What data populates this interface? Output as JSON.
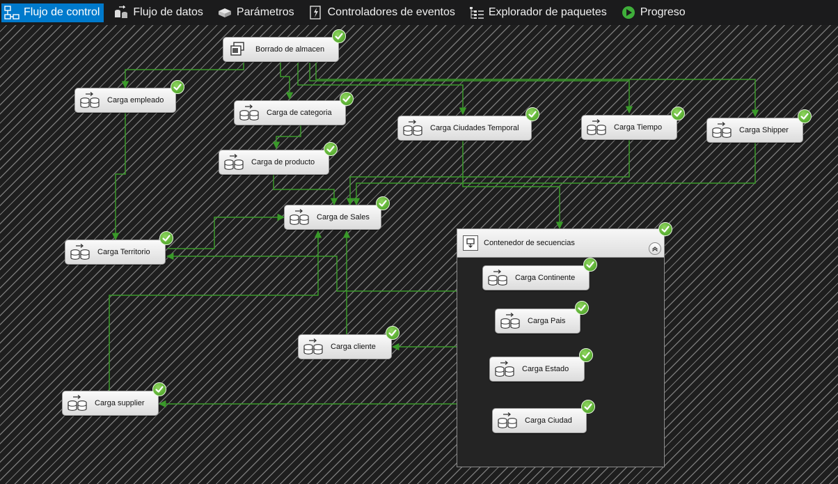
{
  "tabs": [
    {
      "label": "Flujo de control",
      "icon": "control-flow-icon",
      "active": true
    },
    {
      "label": "Flujo de datos",
      "icon": "data-flow-icon",
      "active": false
    },
    {
      "label": "Parámetros",
      "icon": "parameters-icon",
      "active": false
    },
    {
      "label": "Controladores de eventos",
      "icon": "event-handlers-icon",
      "active": false
    },
    {
      "label": "Explorador de paquetes",
      "icon": "package-explorer-icon",
      "active": false
    },
    {
      "label": "Progreso",
      "icon": "progress-icon",
      "active": false
    }
  ],
  "tasks": {
    "borrado": {
      "label": "Borrado de almacen",
      "icon": "sql-task-icon"
    },
    "empleado": {
      "label": "Carga empleado",
      "icon": "data-flow-task-icon"
    },
    "categoria": {
      "label": "Carga de categoria",
      "icon": "data-flow-task-icon"
    },
    "ciudades_temp": {
      "label": "Carga Ciudades Temporal",
      "icon": "data-flow-task-icon"
    },
    "tiempo": {
      "label": "Carga Tiempo",
      "icon": "data-flow-task-icon"
    },
    "shipper": {
      "label": "Carga Shipper",
      "icon": "data-flow-task-icon"
    },
    "producto": {
      "label": "Carga de producto",
      "icon": "data-flow-task-icon"
    },
    "sales": {
      "label": "Carga de Sales",
      "icon": "data-flow-task-icon"
    },
    "territorio": {
      "label": "Carga Territorio",
      "icon": "data-flow-task-icon"
    },
    "cliente": {
      "label": "Carga cliente",
      "icon": "data-flow-task-icon"
    },
    "supplier": {
      "label": "Carga supplier",
      "icon": "data-flow-task-icon"
    },
    "continente": {
      "label": "Carga Continente",
      "icon": "data-flow-task-icon"
    },
    "pais": {
      "label": "Carga Pais",
      "icon": "data-flow-task-icon"
    },
    "estado": {
      "label": "Carga Estado",
      "icon": "data-flow-task-icon"
    },
    "ciudad": {
      "label": "Carga Ciudad",
      "icon": "data-flow-task-icon"
    }
  },
  "container": {
    "label": "Contenedor de secuencias",
    "icon": "sequence-container-icon"
  },
  "status": {
    "all_succeeded": true,
    "icon": "success-check-icon"
  },
  "colors": {
    "accent": "#007acc",
    "connector": "#3a9a2a",
    "success": "#4caf2a",
    "background": "#1e1e1e"
  }
}
